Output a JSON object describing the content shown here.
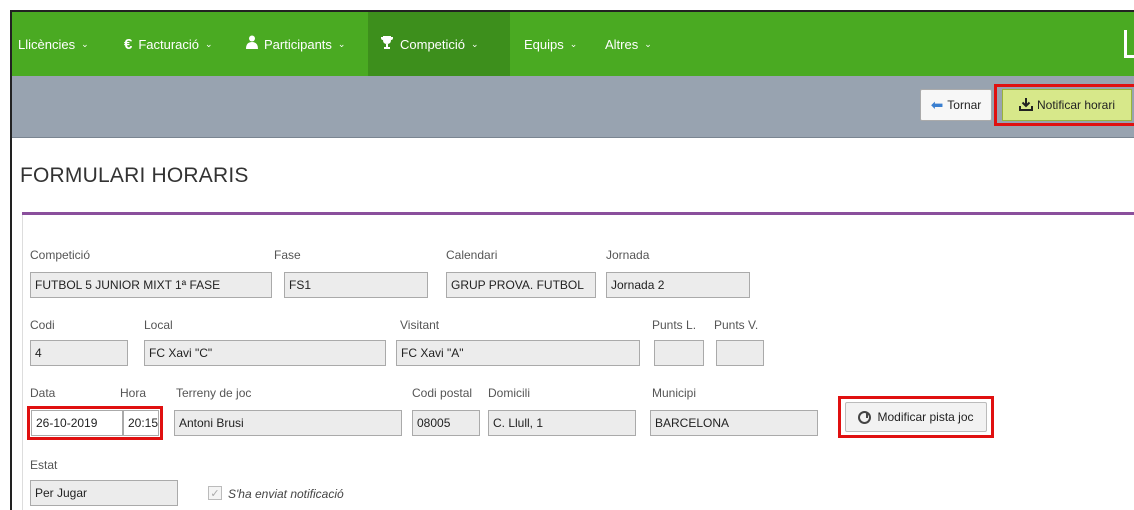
{
  "nav": {
    "items": [
      {
        "label": "Llicències",
        "chevron": "⌄",
        "icon": ""
      },
      {
        "label": "Facturació",
        "chevron": "⌄",
        "icon": "€"
      },
      {
        "label": "Participants",
        "chevron": "⌄",
        "icon": "user-icon"
      },
      {
        "label": "Competició",
        "chevron": "⌄",
        "icon": "trophy-icon"
      },
      {
        "label": "Equips",
        "chevron": "⌄",
        "icon": ""
      },
      {
        "label": "Altres",
        "chevron": "⌄",
        "icon": ""
      }
    ],
    "active": "Competició",
    "color": "#4aaa22"
  },
  "toolbar": {
    "back_label": "Tornar",
    "notify_label": "Notificar horari"
  },
  "page": {
    "title": "FORMULARI HORARIS"
  },
  "form": {
    "competicio": {
      "label": "Competició",
      "value": "FUTBOL 5 JUNIOR MIXT 1ª FASE"
    },
    "fase": {
      "label": "Fase",
      "value": "FS1"
    },
    "calendari": {
      "label": "Calendari",
      "value": "GRUP PROVA. FUTBOL"
    },
    "jornada": {
      "label": "Jornada",
      "value": "Jornada 2"
    },
    "codi": {
      "label": "Codi",
      "value": "4"
    },
    "local": {
      "label": "Local",
      "value": "FC Xavi \"C\""
    },
    "visitant": {
      "label": "Visitant",
      "value": "FC Xavi \"A\""
    },
    "punts_l": {
      "label": "Punts L.",
      "value": ""
    },
    "punts_v": {
      "label": "Punts V.",
      "value": ""
    },
    "data": {
      "label": "Data",
      "value": "26-10-2019"
    },
    "hora": {
      "label": "Hora",
      "value": "20:15"
    },
    "terreny": {
      "label": "Terreny de joc",
      "value": "Antoni Brusi"
    },
    "codi_postal": {
      "label": "Codi postal",
      "value": "08005"
    },
    "domicili": {
      "label": "Domicili",
      "value": "C. Llull, 1"
    },
    "municipi": {
      "label": "Municipi",
      "value": "BARCELONA"
    },
    "modify_label": "Modificar pista joc",
    "estat": {
      "label": "Estat",
      "value": "Per Jugar"
    },
    "notif_sent_label": "S'ha enviat notificació"
  },
  "colors": {
    "highlight": "#e01010",
    "rule": "#8a4f9c"
  }
}
